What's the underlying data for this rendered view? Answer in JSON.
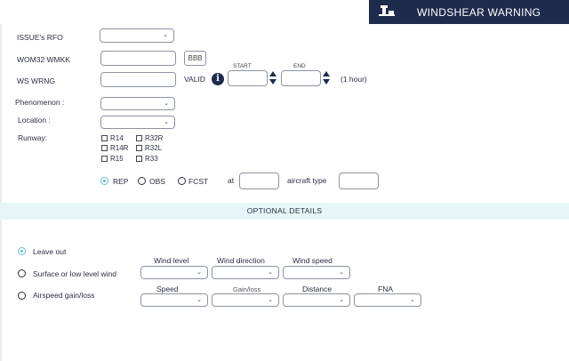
{
  "header": {
    "title": "WINDSHEAR WARNING",
    "icon": "airport-tower-icon"
  },
  "form": {
    "issuer_label": "ISSUE's RFO",
    "header_code_label": "WOM32 WMKK",
    "bbb_label": "BBB",
    "ws_wrng_label": "WS WRNG",
    "valid_label": "VALID",
    "start_label": "START",
    "end_label": "END",
    "duration": "(1 hour)",
    "phenomenon_label": "Phenomenon :",
    "location_label": "Location :",
    "runway_label": "Runway:",
    "runways": [
      "R14",
      "R32R",
      "R14R",
      "R32L",
      "R15",
      "R33"
    ],
    "obs_options": [
      "REP",
      "OBS",
      "FCST"
    ],
    "obs_selected": "REP",
    "at_label": "at",
    "aircraft_type_label": "aircraft type"
  },
  "optional": {
    "title": "OPTIONAL DETAILS",
    "choices": [
      "Leave out",
      "Surface or low level wind",
      "Airspeed gain/loss"
    ],
    "selected": "Leave out",
    "wind_level_label": "Wind level",
    "wind_direction_label": "Wind direction",
    "wind_speed_label": "Wind speed",
    "speed_label": "Speed",
    "gain_loss_label": "Gain/loss",
    "distance_label": "Distance",
    "fna_label": "FNA"
  },
  "colors": {
    "header_bg": "#1e2b4d",
    "accent": "#66c2c9",
    "band": "#e6f6f8"
  }
}
